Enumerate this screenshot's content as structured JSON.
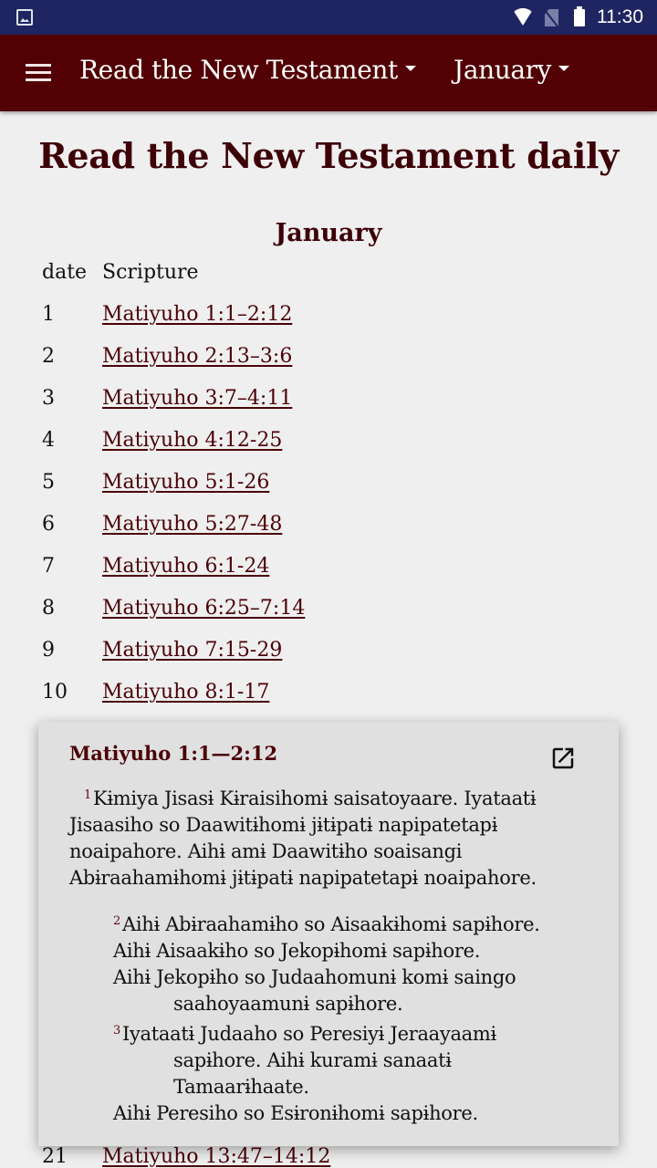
{
  "status_bar": {
    "time": "11:30",
    "icons": [
      "image-notification-icon",
      "wifi-icon",
      "no-sim-icon",
      "battery-icon"
    ]
  },
  "app_bar": {
    "menu_icon": "hamburger-menu-icon",
    "book_selector": "Read the New Testament",
    "month_selector": "January"
  },
  "page": {
    "title": "Read the New Testament daily",
    "month": "January",
    "columns": {
      "date": "date",
      "scripture": "Scripture"
    },
    "rows": [
      {
        "date": "1",
        "ref": "Matiyuho 1:1–2:12"
      },
      {
        "date": "2",
        "ref": "Matiyuho 2:13–3:6"
      },
      {
        "date": "3",
        "ref": "Matiyuho 3:7–4:11"
      },
      {
        "date": "4",
        "ref": "Matiyuho 4:12-25"
      },
      {
        "date": "5",
        "ref": "Matiyuho 5:1-26"
      },
      {
        "date": "6",
        "ref": "Matiyuho 5:27-48"
      },
      {
        "date": "7",
        "ref": "Matiyuho 6:1-24"
      },
      {
        "date": "8",
        "ref": "Matiyuho 6:25–7:14"
      },
      {
        "date": "9",
        "ref": "Matiyuho 7:15-29"
      },
      {
        "date": "10",
        "ref": "Matiyuho 8:1-17"
      }
    ],
    "row_21": {
      "date": "21",
      "ref": "Matiyuho 13:47–14:12"
    }
  },
  "popup": {
    "title": "Matiyuho 1:1—2:12",
    "open_icon": "open-in-new-icon",
    "verse1_num": "1",
    "verse1_text": "Kɨmiya Jisasɨ Kɨraisihomɨ saisatoyaare. Iyataatɨ Jisaasiho so Daawitɨhomɨ jɨtɨpatɨ napipatetapɨ noaipahore. Aihɨ amɨ Daawitɨho soaisangi Abɨraahamɨhomɨ jɨtɨpatɨ napipatetapɨ noaipahore.",
    "poetry": [
      {
        "verse": "2",
        "text": "Aihɨ Abɨraahamɨho so Aisaakɨhomɨ sapɨhore.",
        "indent": false
      },
      {
        "verse": "",
        "text": "Aihɨ Aisaakɨho so Jekopɨhomɨ sapɨhore.",
        "indent": false
      },
      {
        "verse": "",
        "text": "Aihɨ Jekopɨho so Judaahomunɨ komɨ saingo",
        "indent": false
      },
      {
        "verse": "",
        "text": "saahoyaamunɨ sapɨhore.",
        "indent": true
      },
      {
        "verse": "3",
        "text": "Iyataatɨ Judaaho so Peresiyɨ Jeraayaamɨ",
        "indent": false
      },
      {
        "verse": "",
        "text": "sapɨhore. Aihɨ kuramɨ sanaatɨ",
        "indent": true
      },
      {
        "verse": "",
        "text": "Tamaarɨhaate.",
        "indent": true
      },
      {
        "verse": "",
        "text": "Aihɨ Peresiho so Esɨronɨhomɨ sapɨhore.",
        "indent": false
      }
    ]
  }
}
